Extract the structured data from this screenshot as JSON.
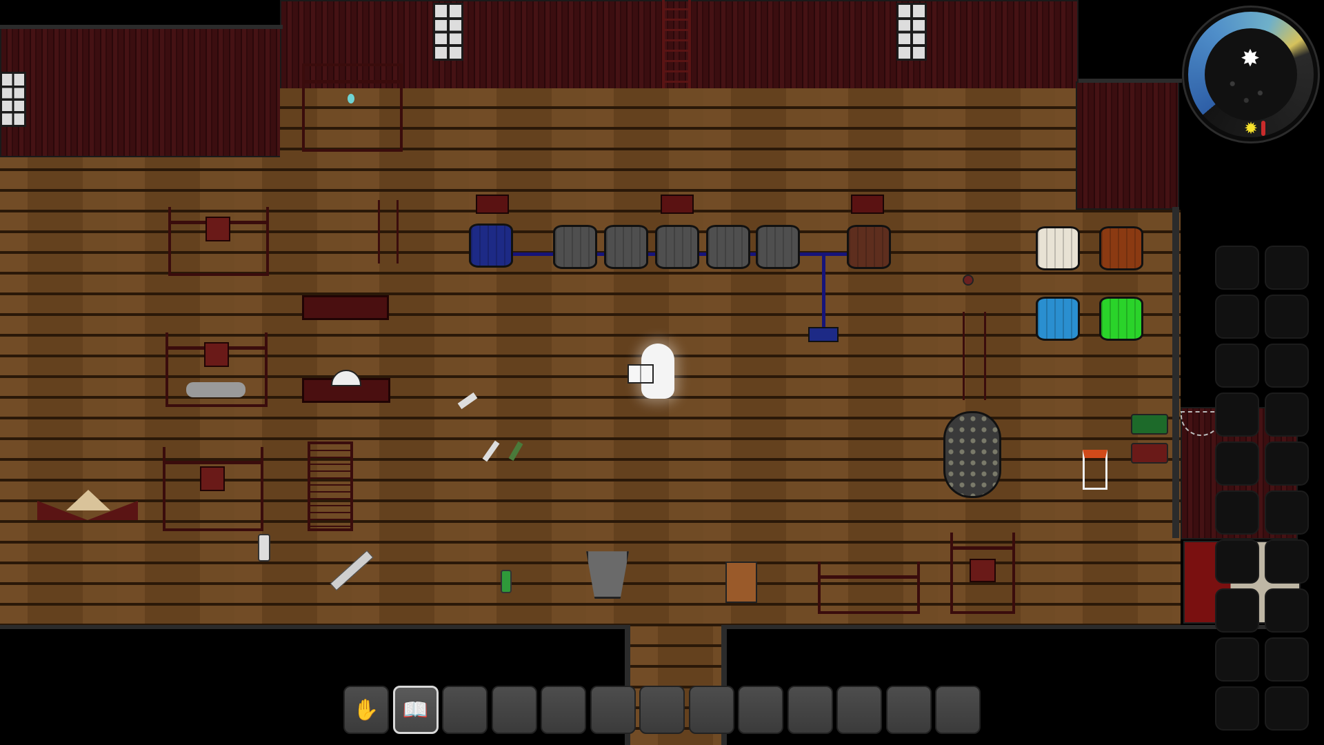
{
  "game": {
    "scene": "workshop-interior",
    "colors": {
      "floor": "#6a4520",
      "wall": "#3b0e10",
      "pipe": "#16147a",
      "ghost": "#f4f4f4"
    }
  },
  "hud": {
    "clock": {
      "moon_icon": "✸",
      "sun_icon": "✹",
      "phase": "night"
    },
    "hotbar": {
      "selected_index": 1,
      "slots": [
        {
          "icon": "hand-icon",
          "glyph": "✋"
        },
        {
          "icon": "book-icon",
          "glyph": "📖"
        },
        {
          "icon": "",
          "glyph": ""
        },
        {
          "icon": "",
          "glyph": ""
        },
        {
          "icon": "",
          "glyph": ""
        },
        {
          "icon": "",
          "glyph": ""
        },
        {
          "icon": "",
          "glyph": ""
        },
        {
          "icon": "",
          "glyph": ""
        },
        {
          "icon": "",
          "glyph": ""
        },
        {
          "icon": "",
          "glyph": ""
        },
        {
          "icon": "",
          "glyph": ""
        },
        {
          "icon": "",
          "glyph": ""
        },
        {
          "icon": "",
          "glyph": ""
        }
      ]
    },
    "side_inventory": {
      "rows": 10,
      "columns": 2
    }
  },
  "objects": {
    "barrel_colors": [
      "blue",
      "gray",
      "gray",
      "gray",
      "gray",
      "gray",
      "brown",
      "white",
      "orange",
      "cyan",
      "green"
    ]
  }
}
